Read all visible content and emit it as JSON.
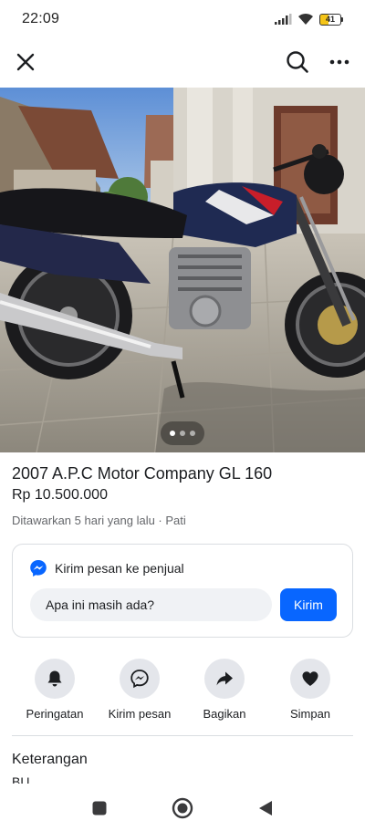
{
  "status_bar": {
    "time": "22:09",
    "battery_level": "41",
    "icons": [
      "signal-icon",
      "wifi-icon",
      "battery-icon"
    ]
  },
  "app_bar": {
    "icons": [
      "close-icon",
      "search-icon",
      "more-icon"
    ]
  },
  "photo": {
    "description_icon": "motorcycle-photo",
    "carousel": {
      "count": 3,
      "active_index": 0
    }
  },
  "listing": {
    "title": "2007 A.P.C Motor Company GL 160",
    "price": "Rp 10.500.000",
    "meta": "Ditawarkan 5 hari yang lalu · Pati"
  },
  "message_card": {
    "header_label": "Kirim pesan ke penjual",
    "input_value": "Apa ini masih ada?",
    "send_label": "Kirim",
    "accent_color": "#0866ff"
  },
  "actions": [
    {
      "label": "Peringatan",
      "icon": "bell-icon"
    },
    {
      "label": "Kirim pesan",
      "icon": "messenger-icon"
    },
    {
      "label": "Bagikan",
      "icon": "share-icon"
    },
    {
      "label": "Simpan",
      "icon": "heart-icon"
    }
  ],
  "description": {
    "title": "Keterangan",
    "body": "BU"
  },
  "nav_bar": {
    "icons": [
      "recents-icon",
      "home-icon",
      "back-icon"
    ]
  }
}
